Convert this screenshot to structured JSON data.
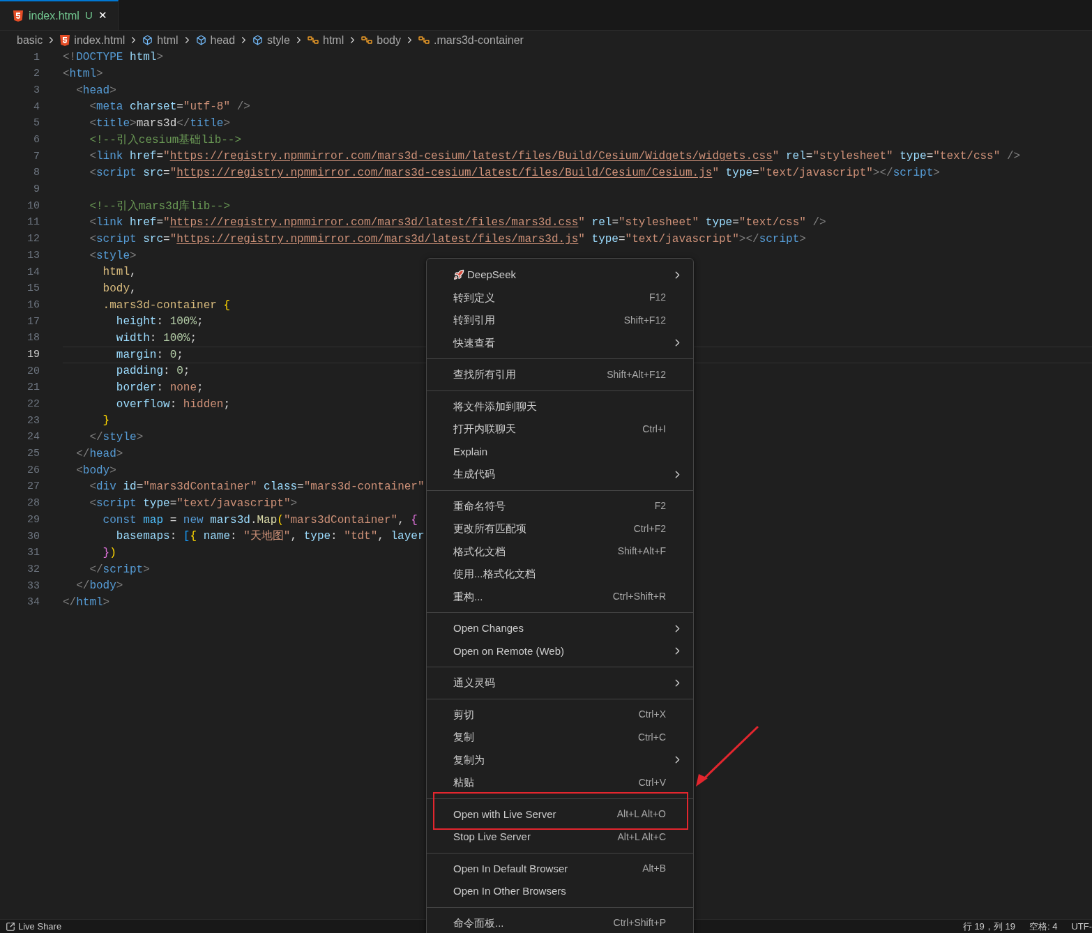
{
  "tab": {
    "label": "index.html",
    "badge": "U",
    "close": "✕",
    "selected": true
  },
  "breadcrumbs": [
    {
      "kind": "folder",
      "label": "basic"
    },
    {
      "kind": "file",
      "label": "index.html"
    },
    {
      "kind": "element",
      "label": "html"
    },
    {
      "kind": "element",
      "label": "head"
    },
    {
      "kind": "element",
      "label": "style"
    },
    {
      "kind": "selector",
      "label": "html"
    },
    {
      "kind": "selector",
      "label": "body"
    },
    {
      "kind": "selector",
      "label": ".mars3d-container"
    }
  ],
  "editor": {
    "lines": [
      {
        "number": "1",
        "selected": false,
        "tokens": [
          {
            "kind": "p",
            "text": "<!"
          },
          {
            "kind": "tag",
            "text": "DOCTYPE"
          },
          {
            "kind": "attr",
            "text": " html"
          },
          {
            "kind": "p",
            "text": ">"
          }
        ]
      },
      {
        "number": "2",
        "selected": false,
        "tokens": [
          {
            "kind": "p",
            "text": "<"
          },
          {
            "kind": "tag",
            "text": "html"
          },
          {
            "kind": "p",
            "text": ">"
          }
        ]
      },
      {
        "number": "3",
        "selected": false,
        "tokens": [
          {
            "kind": "p",
            "text": "  <"
          },
          {
            "kind": "tag",
            "text": "head"
          },
          {
            "kind": "p",
            "text": ">"
          }
        ]
      },
      {
        "number": "4",
        "selected": false,
        "tokens": [
          {
            "kind": "p",
            "text": "    <"
          },
          {
            "kind": "tag",
            "text": "meta"
          },
          {
            "kind": "attr",
            "text": " charset"
          },
          {
            "kind": "txt",
            "text": "="
          },
          {
            "kind": "str",
            "text": "\"utf-8\""
          },
          {
            "kind": "p",
            "text": " />"
          }
        ]
      },
      {
        "number": "5",
        "selected": false,
        "tokens": [
          {
            "kind": "p",
            "text": "    <"
          },
          {
            "kind": "tag",
            "text": "title"
          },
          {
            "kind": "p",
            "text": ">"
          },
          {
            "kind": "txt",
            "text": "mars3d"
          },
          {
            "kind": "p",
            "text": "</"
          },
          {
            "kind": "tag",
            "text": "title"
          },
          {
            "kind": "p",
            "text": ">"
          }
        ]
      },
      {
        "number": "6",
        "selected": false,
        "tokens": [
          {
            "kind": "cmt",
            "text": "    <!--引入cesium基础lib-->"
          }
        ]
      },
      {
        "number": "7",
        "selected": false,
        "tokens": [
          {
            "kind": "p",
            "text": "    <"
          },
          {
            "kind": "tag",
            "text": "link"
          },
          {
            "kind": "attr",
            "text": " href"
          },
          {
            "kind": "txt",
            "text": "="
          },
          {
            "kind": "str",
            "text": "\""
          },
          {
            "kind": "url",
            "text": "https://registry.npmmirror.com/mars3d-cesium/latest/files/Build/Cesium/Widgets/widgets.css"
          },
          {
            "kind": "str",
            "text": "\""
          },
          {
            "kind": "attr",
            "text": " rel"
          },
          {
            "kind": "txt",
            "text": "="
          },
          {
            "kind": "str",
            "text": "\"stylesheet\""
          },
          {
            "kind": "attr",
            "text": " type"
          },
          {
            "kind": "txt",
            "text": "="
          },
          {
            "kind": "str",
            "text": "\"text/css\""
          },
          {
            "kind": "p",
            "text": " />"
          }
        ]
      },
      {
        "number": "8",
        "selected": false,
        "tokens": [
          {
            "kind": "p",
            "text": "    <"
          },
          {
            "kind": "tag",
            "text": "script"
          },
          {
            "kind": "attr",
            "text": " src"
          },
          {
            "kind": "txt",
            "text": "="
          },
          {
            "kind": "str",
            "text": "\""
          },
          {
            "kind": "url",
            "text": "https://registry.npmmirror.com/mars3d-cesium/latest/files/Build/Cesium/Cesium.js"
          },
          {
            "kind": "str",
            "text": "\""
          },
          {
            "kind": "attr",
            "text": " type"
          },
          {
            "kind": "txt",
            "text": "="
          },
          {
            "kind": "str",
            "text": "\"text/javascript\""
          },
          {
            "kind": "p",
            "text": "></"
          },
          {
            "kind": "tag",
            "text": "script"
          },
          {
            "kind": "p",
            "text": ">"
          }
        ]
      },
      {
        "number": "9",
        "selected": false
      },
      {
        "number": "10",
        "selected": false,
        "tokens": [
          {
            "kind": "cmt",
            "text": "    <!--引入mars3d库lib-->"
          }
        ]
      },
      {
        "number": "11",
        "selected": false,
        "tokens": [
          {
            "kind": "p",
            "text": "    <"
          },
          {
            "kind": "tag",
            "text": "link"
          },
          {
            "kind": "attr",
            "text": " href"
          },
          {
            "kind": "txt",
            "text": "="
          },
          {
            "kind": "str",
            "text": "\""
          },
          {
            "kind": "url",
            "text": "https://registry.npmmirror.com/mars3d/latest/files/mars3d.css"
          },
          {
            "kind": "str",
            "text": "\""
          },
          {
            "kind": "attr",
            "text": " rel"
          },
          {
            "kind": "txt",
            "text": "="
          },
          {
            "kind": "str",
            "text": "\"stylesheet\""
          },
          {
            "kind": "attr",
            "text": " type"
          },
          {
            "kind": "txt",
            "text": "="
          },
          {
            "kind": "str",
            "text": "\"text/css\""
          },
          {
            "kind": "p",
            "text": " />"
          }
        ]
      },
      {
        "number": "12",
        "selected": false,
        "tokens": [
          {
            "kind": "p",
            "text": "    <"
          },
          {
            "kind": "tag",
            "text": "script"
          },
          {
            "kind": "attr",
            "text": " src"
          },
          {
            "kind": "txt",
            "text": "="
          },
          {
            "kind": "str",
            "text": "\""
          },
          {
            "kind": "url",
            "text": "https://registry.npmmirror.com/mars3d/latest/files/mars3d.js"
          },
          {
            "kind": "str",
            "text": "\""
          },
          {
            "kind": "attr",
            "text": " type"
          },
          {
            "kind": "txt",
            "text": "="
          },
          {
            "kind": "str",
            "text": "\"text/javascript\""
          },
          {
            "kind": "p",
            "text": "></"
          },
          {
            "kind": "tag",
            "text": "script"
          },
          {
            "kind": "p",
            "text": ">"
          }
        ]
      },
      {
        "number": "13",
        "selected": false,
        "tokens": [
          {
            "kind": "p",
            "text": "    <"
          },
          {
            "kind": "tag",
            "text": "style"
          },
          {
            "kind": "p",
            "text": ">"
          }
        ]
      },
      {
        "number": "14",
        "selected": false,
        "tokens": [
          {
            "kind": "sel",
            "text": "      html"
          },
          {
            "kind": "txt",
            "text": ","
          }
        ]
      },
      {
        "number": "15",
        "selected": false,
        "tokens": [
          {
            "kind": "sel",
            "text": "      body"
          },
          {
            "kind": "txt",
            "text": ","
          }
        ]
      },
      {
        "number": "16",
        "selected": false,
        "tokens": [
          {
            "kind": "sel",
            "text": "      .mars3d-container"
          },
          {
            "kind": "y",
            "text": " {"
          }
        ]
      },
      {
        "number": "17",
        "selected": false,
        "tokens": [
          {
            "kind": "prop",
            "text": "        height"
          },
          {
            "kind": "txt",
            "text": ": "
          },
          {
            "kind": "num",
            "text": "100%"
          },
          {
            "kind": "txt",
            "text": ";"
          }
        ]
      },
      {
        "number": "18",
        "selected": false,
        "tokens": [
          {
            "kind": "prop",
            "text": "        width"
          },
          {
            "kind": "txt",
            "text": ": "
          },
          {
            "kind": "num",
            "text": "100%"
          },
          {
            "kind": "txt",
            "text": ";"
          }
        ]
      },
      {
        "number": "19",
        "selected": true,
        "tokens": [
          {
            "kind": "prop",
            "text": "        margin"
          },
          {
            "kind": "txt",
            "text": ": "
          },
          {
            "kind": "num",
            "text": "0"
          },
          {
            "kind": "txt",
            "text": ";"
          }
        ]
      },
      {
        "number": "20",
        "selected": false,
        "tokens": [
          {
            "kind": "prop",
            "text": "        padding"
          },
          {
            "kind": "txt",
            "text": ": "
          },
          {
            "kind": "num",
            "text": "0"
          },
          {
            "kind": "txt",
            "text": ";"
          }
        ]
      },
      {
        "number": "21",
        "selected": false,
        "tokens": [
          {
            "kind": "prop",
            "text": "        border"
          },
          {
            "kind": "txt",
            "text": ": "
          },
          {
            "kind": "val",
            "text": "none"
          },
          {
            "kind": "txt",
            "text": ";"
          }
        ]
      },
      {
        "number": "22",
        "selected": false,
        "tokens": [
          {
            "kind": "prop",
            "text": "        overflow"
          },
          {
            "kind": "txt",
            "text": ": "
          },
          {
            "kind": "val",
            "text": "hidden"
          },
          {
            "kind": "txt",
            "text": ";"
          }
        ]
      },
      {
        "number": "23",
        "selected": false,
        "tokens": [
          {
            "kind": "y",
            "text": "      }"
          }
        ]
      },
      {
        "number": "24",
        "selected": false,
        "tokens": [
          {
            "kind": "p",
            "text": "    </"
          },
          {
            "kind": "tag",
            "text": "style"
          },
          {
            "kind": "p",
            "text": ">"
          }
        ]
      },
      {
        "number": "25",
        "selected": false,
        "tokens": [
          {
            "kind": "p",
            "text": "  </"
          },
          {
            "kind": "tag",
            "text": "head"
          },
          {
            "kind": "p",
            "text": ">"
          }
        ]
      },
      {
        "number": "26",
        "selected": false,
        "tokens": [
          {
            "kind": "p",
            "text": "  <"
          },
          {
            "kind": "tag",
            "text": "body"
          },
          {
            "kind": "p",
            "text": ">"
          }
        ]
      },
      {
        "number": "27",
        "selected": false,
        "tokens": [
          {
            "kind": "p",
            "text": "    <"
          },
          {
            "kind": "tag",
            "text": "div"
          },
          {
            "kind": "attr",
            "text": " id"
          },
          {
            "kind": "txt",
            "text": "="
          },
          {
            "kind": "str",
            "text": "\"mars3dContainer\""
          },
          {
            "kind": "attr",
            "text": " class"
          },
          {
            "kind": "txt",
            "text": "="
          },
          {
            "kind": "str",
            "text": "\"mars3d-container\""
          }
        ]
      },
      {
        "number": "28",
        "selected": false,
        "tokens": [
          {
            "kind": "p",
            "text": "    <"
          },
          {
            "kind": "tag",
            "text": "script"
          },
          {
            "kind": "attr",
            "text": " type"
          },
          {
            "kind": "txt",
            "text": "="
          },
          {
            "kind": "str",
            "text": "\"text/javascript\""
          },
          {
            "kind": "p",
            "text": ">"
          }
        ]
      },
      {
        "number": "29",
        "selected": false,
        "tokens": [
          {
            "kind": "kw",
            "text": "      const"
          },
          {
            "kind": "var",
            "text": " map"
          },
          {
            "kind": "txt",
            "text": " = "
          },
          {
            "kind": "kw",
            "text": "new"
          },
          {
            "kind": "attr",
            "text": " mars3d"
          },
          {
            "kind": "txt",
            "text": "."
          },
          {
            "kind": "fn",
            "text": "Map"
          },
          {
            "kind": "y",
            "text": "("
          },
          {
            "kind": "str",
            "text": "\"mars3dContainer\""
          },
          {
            "kind": "txt",
            "text": ", "
          },
          {
            "kind": "m",
            "text": "{"
          }
        ]
      },
      {
        "number": "30",
        "selected": false,
        "tokens": [
          {
            "kind": "attr",
            "text": "        basemaps"
          },
          {
            "kind": "txt",
            "text": ": "
          },
          {
            "kind": "b",
            "text": "["
          },
          {
            "kind": "y",
            "text": "{"
          },
          {
            "kind": "attr",
            "text": " name"
          },
          {
            "kind": "txt",
            "text": ": "
          },
          {
            "kind": "str",
            "text": "\"天地图\""
          },
          {
            "kind": "txt",
            "text": ", "
          },
          {
            "kind": "attr",
            "text": "type"
          },
          {
            "kind": "txt",
            "text": ": "
          },
          {
            "kind": "str",
            "text": "\"tdt\""
          },
          {
            "kind": "txt",
            "text": ", "
          },
          {
            "kind": "attr",
            "text": "layer"
          }
        ]
      },
      {
        "number": "31",
        "selected": false,
        "tokens": [
          {
            "kind": "m",
            "text": "      }"
          },
          {
            "kind": "y",
            "text": ")"
          }
        ]
      },
      {
        "number": "32",
        "selected": false,
        "tokens": [
          {
            "kind": "p",
            "text": "    </"
          },
          {
            "kind": "tag",
            "text": "script"
          },
          {
            "kind": "p",
            "text": ">"
          }
        ]
      },
      {
        "number": "33",
        "selected": false,
        "tokens": [
          {
            "kind": "p",
            "text": "  </"
          },
          {
            "kind": "tag",
            "text": "body"
          },
          {
            "kind": "p",
            "text": ">"
          }
        ]
      },
      {
        "number": "34",
        "selected": false,
        "tokens": [
          {
            "kind": "p",
            "text": "</"
          },
          {
            "kind": "tag",
            "text": "html"
          },
          {
            "kind": "p",
            "text": ">"
          }
        ]
      }
    ]
  },
  "context_menu": {
    "items": [
      {
        "kind": "iconitem",
        "label": "DeepSeek",
        "submenu": true,
        "highlighted": false
      },
      {
        "kind": "item",
        "label": "转到定义",
        "shortcut": "F12",
        "submenu": false,
        "highlighted": false
      },
      {
        "kind": "item",
        "label": "转到引用",
        "shortcut": "Shift+F12",
        "submenu": false,
        "highlighted": false
      },
      {
        "kind": "item",
        "label": "快速查看",
        "submenu": true,
        "highlighted": false
      },
      {
        "kind": "separator"
      },
      {
        "kind": "item",
        "label": "查找所有引用",
        "shortcut": "Shift+Alt+F12",
        "submenu": false,
        "highlighted": false
      },
      {
        "kind": "separator"
      },
      {
        "kind": "item",
        "label": "将文件添加到聊天",
        "submenu": false,
        "highlighted": false
      },
      {
        "kind": "item",
        "label": "打开内联聊天",
        "shortcut": "Ctrl+I",
        "submenu": false,
        "highlighted": false
      },
      {
        "kind": "item",
        "label": "Explain",
        "submenu": false,
        "highlighted": false
      },
      {
        "kind": "item",
        "label": "生成代码",
        "submenu": true,
        "highlighted": false
      },
      {
        "kind": "separator"
      },
      {
        "kind": "item",
        "label": "重命名符号",
        "shortcut": "F2",
        "submenu": false,
        "highlighted": false
      },
      {
        "kind": "item",
        "label": "更改所有匹配项",
        "shortcut": "Ctrl+F2",
        "submenu": false,
        "highlighted": false
      },
      {
        "kind": "item",
        "label": "格式化文档",
        "shortcut": "Shift+Alt+F",
        "submenu": false,
        "highlighted": false
      },
      {
        "kind": "item",
        "label": "使用...格式化文档",
        "submenu": false,
        "highlighted": false
      },
      {
        "kind": "item",
        "label": "重构...",
        "shortcut": "Ctrl+Shift+R",
        "submenu": false,
        "highlighted": false
      },
      {
        "kind": "separator"
      },
      {
        "kind": "item",
        "label": "Open Changes",
        "submenu": true,
        "highlighted": false
      },
      {
        "kind": "item",
        "label": "Open on Remote (Web)",
        "submenu": true,
        "highlighted": false
      },
      {
        "kind": "separator"
      },
      {
        "kind": "item",
        "label": "通义灵码",
        "submenu": true,
        "highlighted": false
      },
      {
        "kind": "separator"
      },
      {
        "kind": "item",
        "label": "剪切",
        "shortcut": "Ctrl+X",
        "submenu": false,
        "highlighted": false
      },
      {
        "kind": "item",
        "label": "复制",
        "shortcut": "Ctrl+C",
        "submenu": false,
        "highlighted": false
      },
      {
        "kind": "item",
        "label": "复制为",
        "submenu": true,
        "highlighted": false
      },
      {
        "kind": "item",
        "label": "粘贴",
        "shortcut": "Ctrl+V",
        "submenu": false,
        "highlighted": false
      },
      {
        "kind": "separator"
      },
      {
        "kind": "item",
        "label": "Open with Live Server",
        "shortcut": "Alt+L Alt+O",
        "submenu": false,
        "highlighted": true
      },
      {
        "kind": "item",
        "label": "Stop Live Server",
        "shortcut": "Alt+L Alt+C",
        "submenu": false,
        "highlighted": false
      },
      {
        "kind": "separator"
      },
      {
        "kind": "item",
        "label": "Open In Default Browser",
        "shortcut": "Alt+B",
        "submenu": false,
        "highlighted": false
      },
      {
        "kind": "item",
        "label": "Open In Other Browsers",
        "submenu": false,
        "highlighted": false
      },
      {
        "kind": "separator"
      },
      {
        "kind": "item",
        "label": "命令面板...",
        "shortcut": "Ctrl+Shift+P",
        "submenu": false,
        "highlighted": false
      }
    ]
  },
  "status_bar": {
    "left": [
      {
        "kind": "share",
        "label": "Live Share"
      }
    ],
    "right": [
      "行 19，列 19",
      "空格: 4",
      "UTF-"
    ]
  }
}
